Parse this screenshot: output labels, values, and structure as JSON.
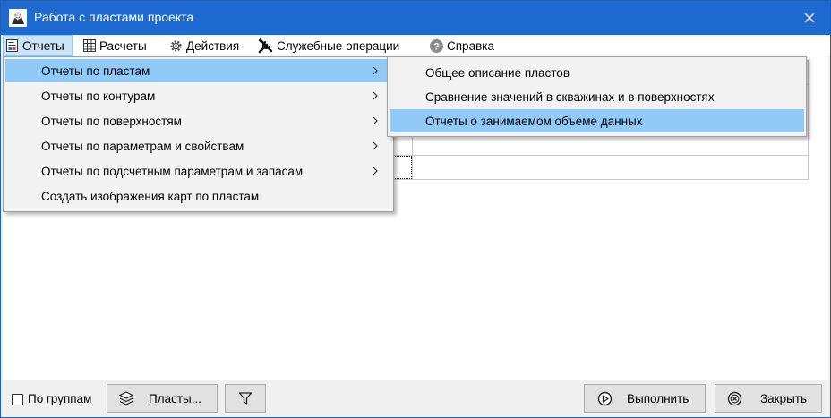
{
  "window": {
    "title": "Работа с пластами проекта"
  },
  "menubar": {
    "items": [
      {
        "label": "Отчеты",
        "icon": "report-icon"
      },
      {
        "label": "Расчеты",
        "icon": "table-icon"
      },
      {
        "label": "Действия",
        "icon": "gear-icon"
      },
      {
        "label": "Служебные операции",
        "icon": "tools-icon"
      },
      {
        "label": "Справка",
        "icon": "help-icon"
      }
    ]
  },
  "reports_menu": {
    "items": [
      {
        "label": "Отчеты по пластам",
        "has_submenu": true
      },
      {
        "label": "Отчеты по контурам",
        "has_submenu": true
      },
      {
        "label": "Отчеты по поверхностям",
        "has_submenu": true
      },
      {
        "label": "Отчеты по параметрам и свойствам",
        "has_submenu": true
      },
      {
        "label": "Отчеты по подсчетным параметрам и запасам",
        "has_submenu": true
      },
      {
        "label": "Создать изображения карт по пластам",
        "has_submenu": false
      }
    ]
  },
  "layers_submenu": {
    "items": [
      {
        "label": "Общее описание пластов"
      },
      {
        "label": "Сравнение значений в скважинах и в поверхностях"
      },
      {
        "label": "Отчеты о занимаемом объеме данных"
      }
    ]
  },
  "bottom": {
    "group_label": "По группам",
    "layers_button": "Пласты...",
    "run_button": "Выполнить",
    "close_button": "Закрыть"
  },
  "colors": {
    "titlebar": "#1e6ad0",
    "selection": "#91c9f7",
    "menu_active": "#cce4f7"
  }
}
